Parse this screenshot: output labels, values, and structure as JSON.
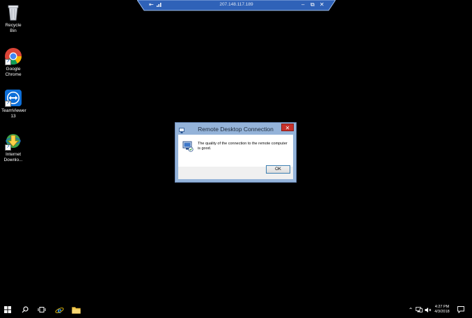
{
  "desktop": {
    "icons": [
      {
        "label_line1": "Recycle Bin",
        "label_line2": ""
      },
      {
        "label_line1": "Google",
        "label_line2": "Chrome"
      },
      {
        "label_line1": "TeamViewer",
        "label_line2": "13"
      },
      {
        "label_line1": "Internet",
        "label_line2": "Downlo..."
      }
    ]
  },
  "connection_bar": {
    "address": "207.148.117.189"
  },
  "dialog": {
    "title": "Remote Desktop Connection",
    "message": "The quality of the connection to the remote computer is good.",
    "ok_label": "OK",
    "close_glyph": "✕"
  },
  "taskbar": {
    "time": "4:27 PM",
    "date": "4/3/2018"
  }
}
